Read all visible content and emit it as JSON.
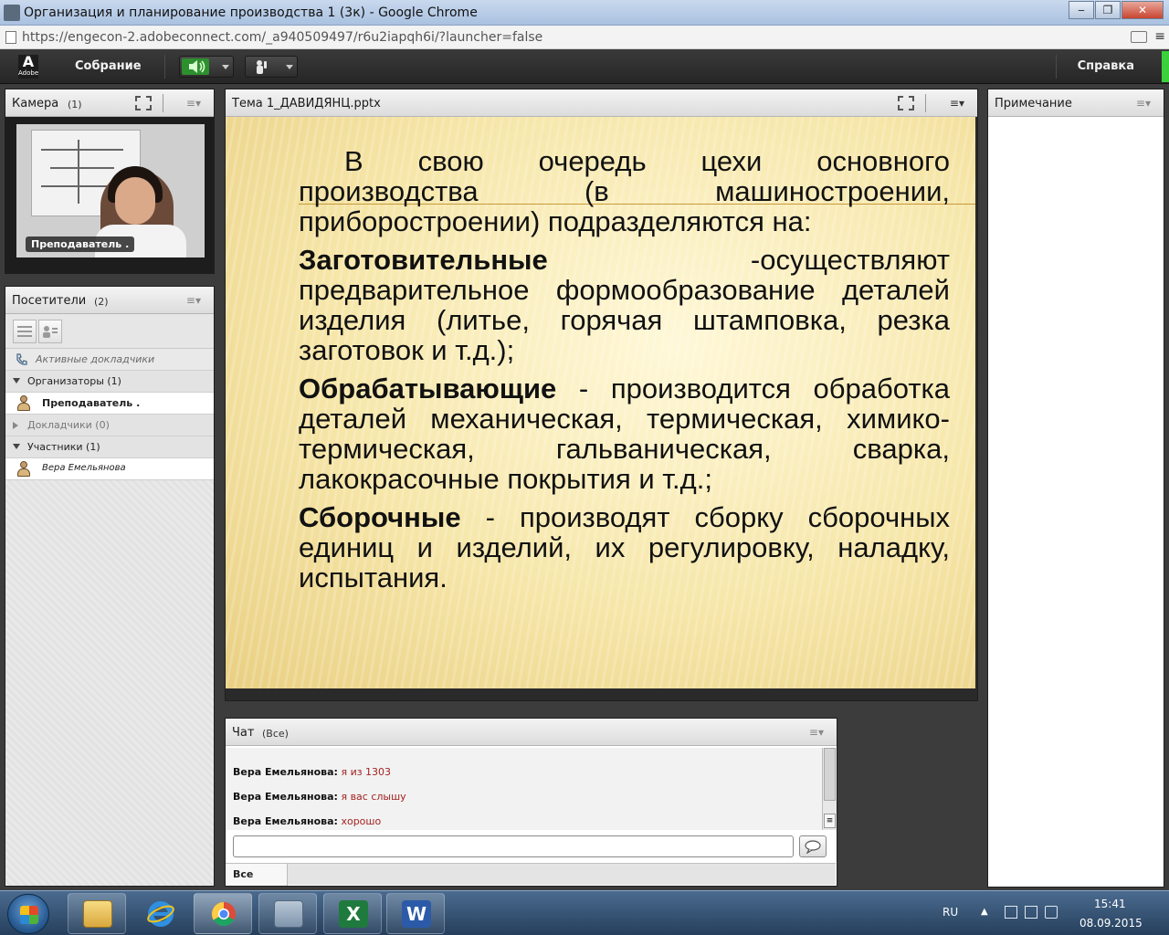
{
  "window": {
    "title": "Организация и планирование производства 1 (3к) - Google Chrome",
    "min_label": "‒",
    "max_label": "❐",
    "close_label": "✕"
  },
  "browser": {
    "url": "https://engecon-2.adobeconnect.com/_a940509497/r6u2iapqh6i/?launcher=false",
    "menu_glyph": "≡"
  },
  "menubar": {
    "logo_letter": "A",
    "logo_text": "Adobe",
    "meeting_label": "Собрание",
    "help_label": "Справка",
    "speaker_color": "#3bc23b"
  },
  "camera_pod": {
    "title": "Камера",
    "count": "(1)",
    "presenter_label": "Преподаватель ."
  },
  "attendees_pod": {
    "title": "Посетители",
    "count": "(2)",
    "active_speakers": "Активные докладчики",
    "groups": [
      {
        "label": "Организаторы (1)",
        "expanded": true,
        "members": [
          "Преподаватель ."
        ]
      },
      {
        "label": "Докладчики (0)",
        "expanded": false,
        "members": []
      },
      {
        "label": "Участники (1)",
        "expanded": true,
        "members": [
          "Вера Емельянова"
        ]
      }
    ]
  },
  "share_pod": {
    "title": "Тема 1_ДАВИДЯНЦ.pptx",
    "slide": {
      "p1": "В свою очередь цехи основного производства (в машиностроении, приборостроении) подразделяются на:",
      "p2_bold": "Заготовительные",
      "p2_rest": " -осуществляют предварительное формообразование деталей изделия (литье, горячая штамповка, резка заготовок и т.д.);",
      "p3_bold": "Обрабатывающие",
      "p3_rest": " - производится обработка деталей механическая, термическая, химико-термическая, гальваническая, сварка, лакокрасочные покрытия и т.д.;",
      "p4_bold": "Сборочные",
      "p4_rest": " - производят сборку сборочных единиц и изделий, их регулировку, наладку, испытания."
    }
  },
  "notes_pod": {
    "title": "Примечание"
  },
  "chat_pod": {
    "title": "Чат",
    "scope": "(Все)",
    "messages": [
      {
        "author": "Вера Емельянова:",
        "text": "я из 1303"
      },
      {
        "author": "Вера Емельянова:",
        "text": "я вас слышу"
      },
      {
        "author": "Вера Емельянова:",
        "text": "хорошо"
      }
    ],
    "input_value": "",
    "tab_all": "Все"
  },
  "taskbar": {
    "apps": [
      "explorer",
      "internet-explorer",
      "chrome",
      "keyboard",
      "excel",
      "word"
    ],
    "language": "RU",
    "time": "15:41",
    "date": "08.09.2015"
  }
}
